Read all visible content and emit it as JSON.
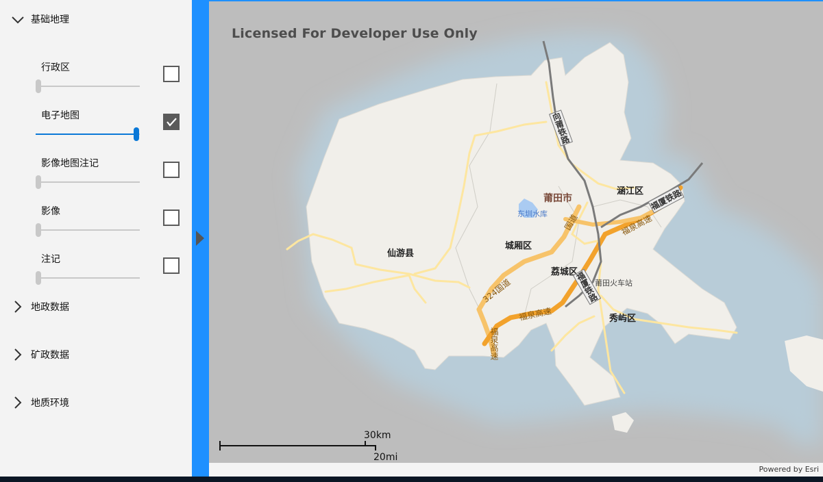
{
  "sidebar": {
    "groups": [
      {
        "label": "基础地理",
        "expanded": true
      },
      {
        "label": "地政数据",
        "expanded": false
      },
      {
        "label": "矿政数据",
        "expanded": false
      },
      {
        "label": "地质环境",
        "expanded": false
      }
    ],
    "layers": [
      {
        "label": "行政区",
        "checked": false,
        "opacity": 0
      },
      {
        "label": "电子地图",
        "checked": true,
        "opacity": 1
      },
      {
        "label": "影像地图注记",
        "checked": false,
        "opacity": 0
      },
      {
        "label": "影像",
        "checked": false,
        "opacity": 0
      },
      {
        "label": "注记",
        "checked": false,
        "opacity": 0
      }
    ]
  },
  "map": {
    "watermark": "Licensed For Developer Use Only",
    "attribution": "Powered by Esri",
    "scale_km": "30km",
    "scale_mi": "20mi",
    "places": {
      "putian": "莆田市",
      "hanjiang": "涵江区",
      "xianyou": "仙游县",
      "chengxiang": "城厢区",
      "licheng": "荔城区",
      "xiuyu": "秀屿区",
      "dongzhen": "东圳水库",
      "station": "莆田火车站"
    },
    "roads": {
      "xiangpu": "向莆铁路",
      "fuxia_rail": "福厦铁路",
      "fuxia_rail2": "福厦铁路",
      "fuquan_hw": "福泉高速",
      "fuquan_hw2": "福泉高速",
      "fuquan_hw3": "福泉高速",
      "g324": "324国道",
      "guodao": "国道"
    },
    "colors": {
      "water": "#bdbdbd",
      "land": "#f1efea",
      "highway": "#f2a22c",
      "road": "#fde6a0",
      "rail": "#666666",
      "accent": "#1e90ff"
    }
  }
}
